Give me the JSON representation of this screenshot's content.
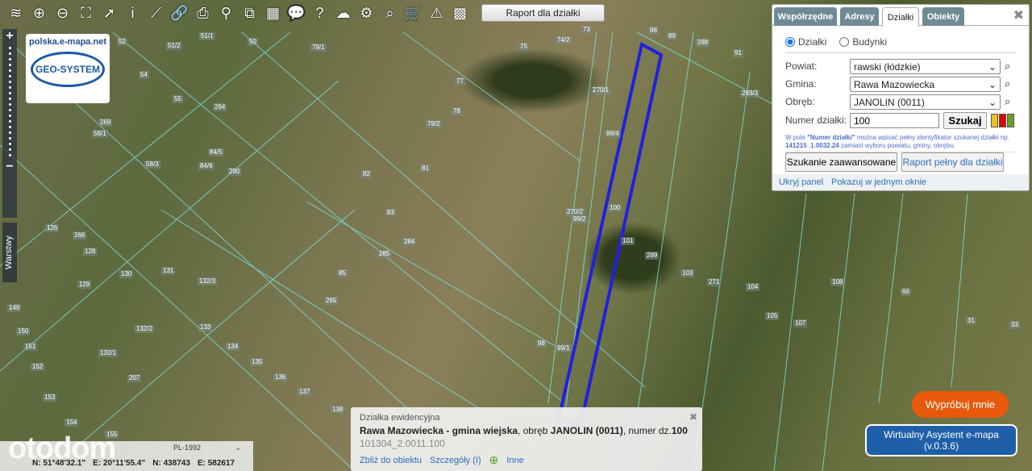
{
  "toolbar": {
    "icons": [
      "layers-icon",
      "zoom-in-icon",
      "zoom-out-icon",
      "fullscreen-icon",
      "pointer-icon",
      "info-icon",
      "measure-icon",
      "link-icon",
      "print-icon",
      "location-icon",
      "compare-icon",
      "layout-icon",
      "comment-icon",
      "help-icon",
      "cloud-download-icon",
      "settings-icon",
      "search-map-icon",
      "cart-icon",
      "warning-icon",
      "palette-icon"
    ],
    "glyphs": [
      "≋",
      "⊕",
      "⊖",
      "⛶",
      "➚",
      "i",
      "⟋",
      "🔗",
      "⎙",
      "⚲",
      "⧉",
      "▦",
      "💬",
      "?",
      "☁",
      "⚙",
      "⌕",
      "🛒",
      "⚠",
      "▩"
    ],
    "report_button": "Raport dla działki"
  },
  "zoom": {
    "plus": "+",
    "minus": "−"
  },
  "layers_label": "Warstwy",
  "logo": {
    "url": "polska.e-mapa.net",
    "brand": "GEO-SYSTEM"
  },
  "panel": {
    "tabs": [
      "Współrzędne",
      "Adresy",
      "Działki",
      "Obiekty"
    ],
    "active_tab": "Działki",
    "radio": {
      "option1": "Działki",
      "option2": "Budynki",
      "selected": "Działki"
    },
    "powiat_label": "Powiat:",
    "powiat_value": "rawski (łódzkie)",
    "gmina_label": "Gmina:",
    "gmina_value": "Rawa Mazowiecka",
    "obreb_label": "Obręb:",
    "obreb_value": "JANOLIN (0011)",
    "numer_label": "Numer działki:",
    "numer_value": "100",
    "search_button": "Szukaj",
    "status_colors": [
      "#f0c020",
      "#e00000",
      "#6aa020"
    ],
    "hint_prefix": "W pole ",
    "hint_field": "\"Numer działki\"",
    "hint_mid": " można wpisać pełny identyfikator szukanej działki np. ",
    "hint_example": "141215_1.0032.24",
    "hint_suffix": " zamiast wyboru powiatu, gminy, obrębu.",
    "advanced_button": "Szukanie zaawansowane",
    "full_report_button": "Raport pełny dla działki",
    "hide_panel": "Ukryj panel",
    "single_window": "Pokazuj w jednym oknie"
  },
  "info": {
    "title": "Działka ewidencyjna",
    "gmina": "Rawa Mazowiecka - gmina wiejska",
    "obreb_text": ", obręb ",
    "obreb": "JANOLIN (0011)",
    "numer_text": ", numer dz.",
    "numer": "100",
    "id": "101304_2.0011.100",
    "zoom_link": "Zbliż do obiektu",
    "details_link": "Szczegóły (I)",
    "other_link": "Inne"
  },
  "coords": {
    "crs": "PL-1992",
    "lat": "N: 51°48'32.1\"",
    "lon": "E: 20°11'55.4\"",
    "n": "N: 438743",
    "e": "E: 582617"
  },
  "watermark": "otodom",
  "assistant": {
    "try": "Wypróbuj mnie",
    "name": "Wirtualny Asystent e-mapa",
    "version": "(v.0.3.6)"
  },
  "parcels": [
    "51/1",
    "50",
    "74/2",
    "73",
    "88",
    "89",
    "288",
    "91",
    "52",
    "51/2",
    "79/1",
    "75",
    "77",
    "270/1",
    "263/3",
    "54",
    "55",
    "264",
    "78",
    "79/2",
    "99/4",
    "269",
    "58/1",
    "84/5",
    "58/3",
    "84/6",
    "290",
    "81",
    "82",
    "83",
    "270/2",
    "99/2",
    "100",
    "126",
    "266",
    "284",
    "101",
    "289",
    "128",
    "285",
    "131",
    "130",
    "132/3",
    "85",
    "103",
    "271",
    "104",
    "108",
    "129",
    "149",
    "265",
    "66",
    "107",
    "105",
    "31",
    "33",
    "150",
    "132/2",
    "133",
    "151",
    "134",
    "98",
    "99/1",
    "132/1",
    "152",
    "135",
    "207",
    "136",
    "137",
    "153",
    "138",
    "154",
    "155"
  ]
}
